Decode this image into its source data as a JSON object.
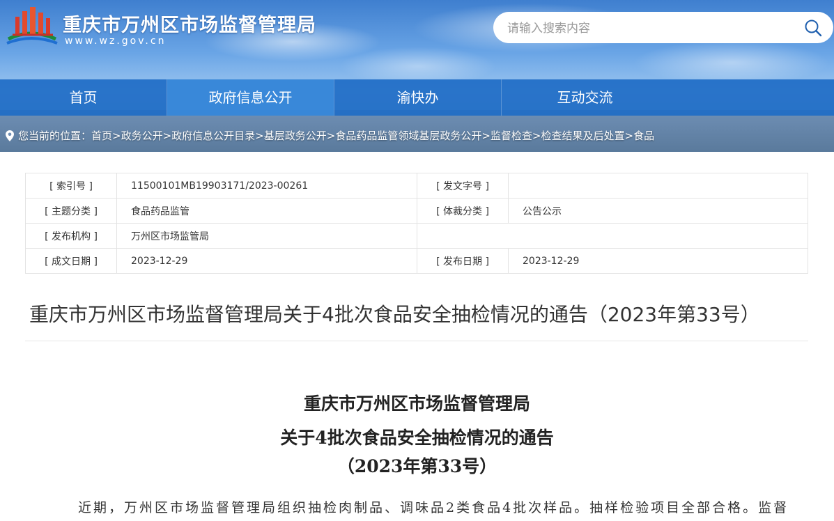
{
  "header": {
    "site_title": "重庆市万州区市场监督管理局",
    "site_url": "www.wz.gov.cn",
    "logo_icon": "city-emblem-icon"
  },
  "search": {
    "placeholder": "请输入搜索内容",
    "button_icon": "search-icon"
  },
  "nav": {
    "items": [
      {
        "label": "首页"
      },
      {
        "label": "政府信息公开"
      },
      {
        "label": "渝快办"
      },
      {
        "label": "互动交流"
      }
    ],
    "active_index": 1,
    "bg_color": "#206cc5"
  },
  "breadcrumb": {
    "icon": "location-pin-icon",
    "prefix": "您当前的位置：",
    "items": [
      "首页",
      ">政务公开",
      ">政府信息公开目录",
      ">基层政务公开",
      ">食品药品监管领域基层政务公开",
      ">监督检查",
      ">检查结果及后处置",
      ">食品"
    ]
  },
  "meta": {
    "index_label": "[ 索引号 ]",
    "index_value": "11500101MB19903171/2023-00261",
    "doc_no_label": "[ 发文字号 ]",
    "doc_no_value": "",
    "topic_label": "[ 主题分类 ]",
    "topic_value": "食品药品监管",
    "genre_label": "[ 体裁分类 ]",
    "genre_value": "公告公示",
    "issuer_label": "[ 发布机构 ]",
    "issuer_value": "万州区市场监管局",
    "created_label": "[ 成文日期 ]",
    "created_value": "2023-12-29",
    "published_label": "[ 发布日期 ]",
    "published_value": "2023-12-29"
  },
  "article": {
    "title": "重庆市万州区市场监督管理局关于4批次食品安全抽检情况的通告（2023年第33号）",
    "heading_line1": "重庆市万州区市场监督管理局",
    "heading_line2": "关于4批次食品安全抽检情况的通告",
    "heading_line3": "（2023年第33号）",
    "body_start": "近期，万州区市场监督管理局组织抽检肉制品、调味品2类食品4批次样品。抽样检验项目全部合格。监督抽"
  }
}
